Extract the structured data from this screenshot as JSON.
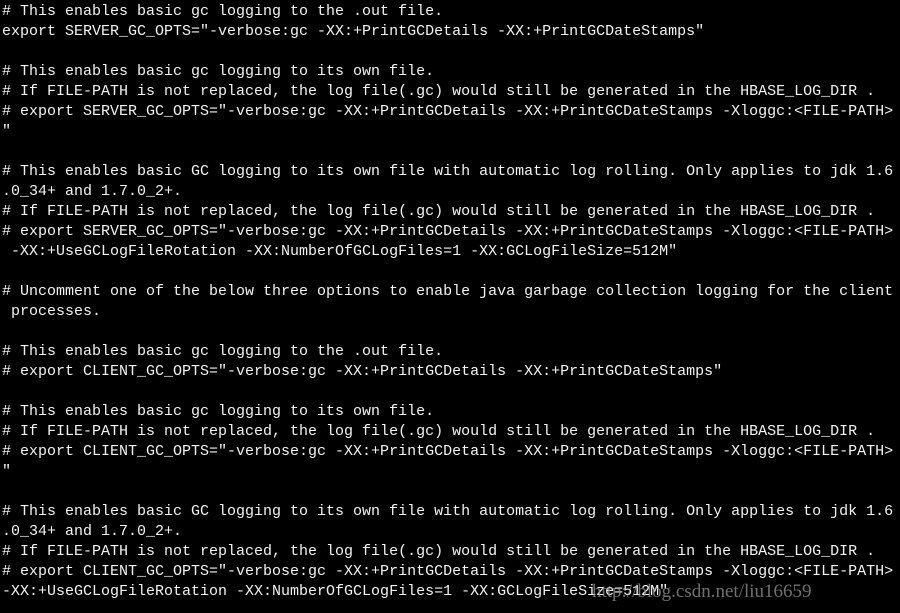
{
  "terminal": {
    "lines": [
      "# This enables basic gc logging to the .out file.",
      "export SERVER_GC_OPTS=\"-verbose:gc -XX:+PrintGCDetails -XX:+PrintGCDateStamps\"",
      "",
      "# This enables basic gc logging to its own file.",
      "# If FILE-PATH is not replaced, the log file(.gc) would still be generated in the HBASE_LOG_DIR .",
      "# export SERVER_GC_OPTS=\"-verbose:gc -XX:+PrintGCDetails -XX:+PrintGCDateStamps -Xloggc:<FILE-PATH>",
      "\"",
      "",
      "# This enables basic GC logging to its own file with automatic log rolling. Only applies to jdk 1.6",
      ".0_34+ and 1.7.0_2+.",
      "# If FILE-PATH is not replaced, the log file(.gc) would still be generated in the HBASE_LOG_DIR .",
      "# export SERVER_GC_OPTS=\"-verbose:gc -XX:+PrintGCDetails -XX:+PrintGCDateStamps -Xloggc:<FILE-PATH>",
      " -XX:+UseGCLogFileRotation -XX:NumberOfGCLogFiles=1 -XX:GCLogFileSize=512M\"",
      "",
      "# Uncomment one of the below three options to enable java garbage collection logging for the client",
      " processes.",
      "",
      "# This enables basic gc logging to the .out file.",
      "# export CLIENT_GC_OPTS=\"-verbose:gc -XX:+PrintGCDetails -XX:+PrintGCDateStamps\"",
      "",
      "# This enables basic gc logging to its own file.",
      "# If FILE-PATH is not replaced, the log file(.gc) would still be generated in the HBASE_LOG_DIR .",
      "# export CLIENT_GC_OPTS=\"-verbose:gc -XX:+PrintGCDetails -XX:+PrintGCDateStamps -Xloggc:<FILE-PATH>",
      "\"",
      "",
      "# This enables basic GC logging to its own file with automatic log rolling. Only applies to jdk 1.6",
      ".0_34+ and 1.7.0_2+.",
      "# If FILE-PATH is not replaced, the log file(.gc) would still be generated in the HBASE_LOG_DIR .",
      "# export CLIENT_GC_OPTS=\"-verbose:gc -XX:+PrintGCDetails -XX:+PrintGCDateStamps -Xloggc:<FILE-PATH>",
      "-XX:+UseGCLogFileRotation -XX:NumberOfGCLogFiles=1 -XX:GCLogFileSize=512M\""
    ]
  },
  "watermark": "http://blog.csdn.net/liu16659",
  "colors": {
    "background": "#000000",
    "text": "#f2f2f2"
  }
}
